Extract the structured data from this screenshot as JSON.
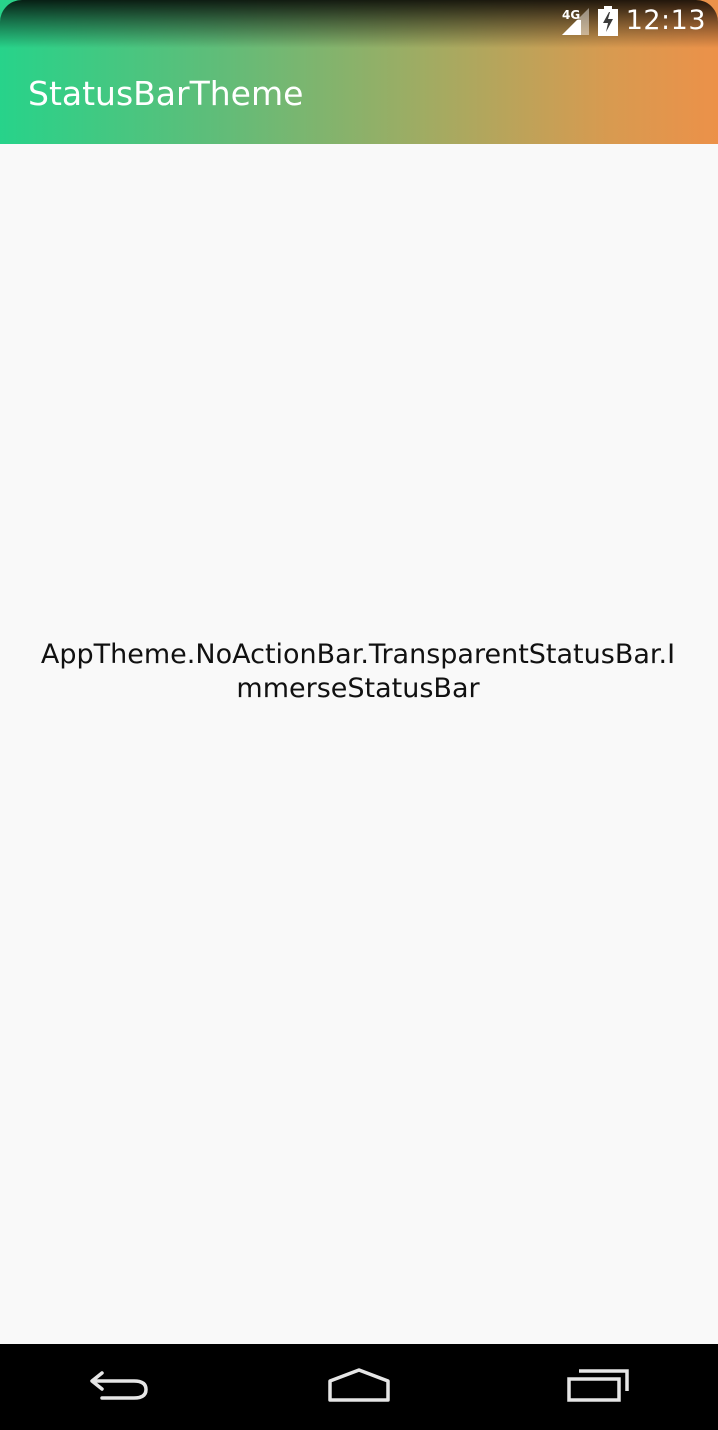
{
  "status_bar": {
    "network_label": "4G",
    "time": "12:13",
    "icons": [
      "signal-4g-icon",
      "battery-charging-icon"
    ]
  },
  "app_bar": {
    "title": "StatusBarTheme",
    "gradient_colors": [
      "#27d38a",
      "#a2ab62",
      "#ec9149"
    ]
  },
  "main": {
    "text": "AppTheme.NoActionBar.TransparentStatusBar.ImmerseStatusBar"
  },
  "nav_bar": {
    "buttons": [
      "back-icon",
      "home-icon",
      "recents-icon"
    ]
  }
}
